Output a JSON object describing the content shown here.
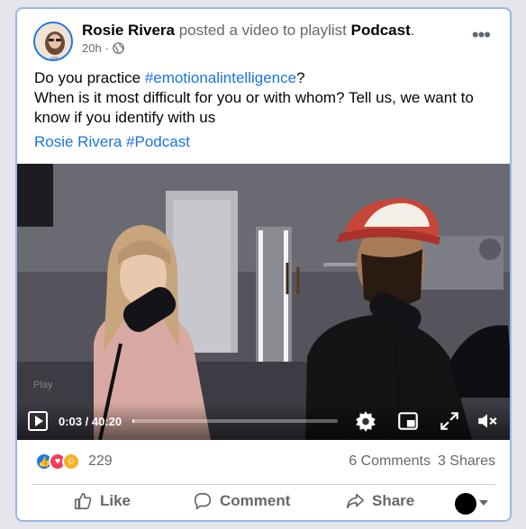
{
  "post": {
    "author": "Rosie Rivera",
    "action_text": " posted a video to playlist ",
    "playlist": "Podcast",
    "period": ".",
    "time": "20h",
    "separator": "·",
    "text_line1_a": "Do you practice ",
    "hashtag": "#emotionalintelligence",
    "text_line1_b": "?",
    "text_line2": "When is it most difficult for you or with whom? Tell us, we want to know if you identify with us",
    "playlist_link": "Rosie Rivera #Podcast"
  },
  "video": {
    "current_time": "0:03",
    "duration": "40:20",
    "time_display": "0:03 / 40:20",
    "progress_fraction": 0.0012,
    "watermark": "Play"
  },
  "footer": {
    "reaction_count": "229",
    "comments": "6 Comments",
    "shares": "3 Shares",
    "like_label": "Like",
    "comment_label": "Comment",
    "share_label": "Share"
  },
  "colors": {
    "link": "#1b74e4",
    "muted": "#65676b",
    "like_blue": "#1877f2",
    "love_red": "#f33e58",
    "care_yellow": "#f7b125"
  },
  "icons": [
    "globe-icon",
    "more-icon",
    "play-icon",
    "settings-icon",
    "pip-icon",
    "fullscreen-icon",
    "mute-icon",
    "like-reaction-icon",
    "love-reaction-icon",
    "care-reaction-icon",
    "thumbs-up-icon",
    "comment-icon",
    "share-icon",
    "caret-down-icon"
  ]
}
